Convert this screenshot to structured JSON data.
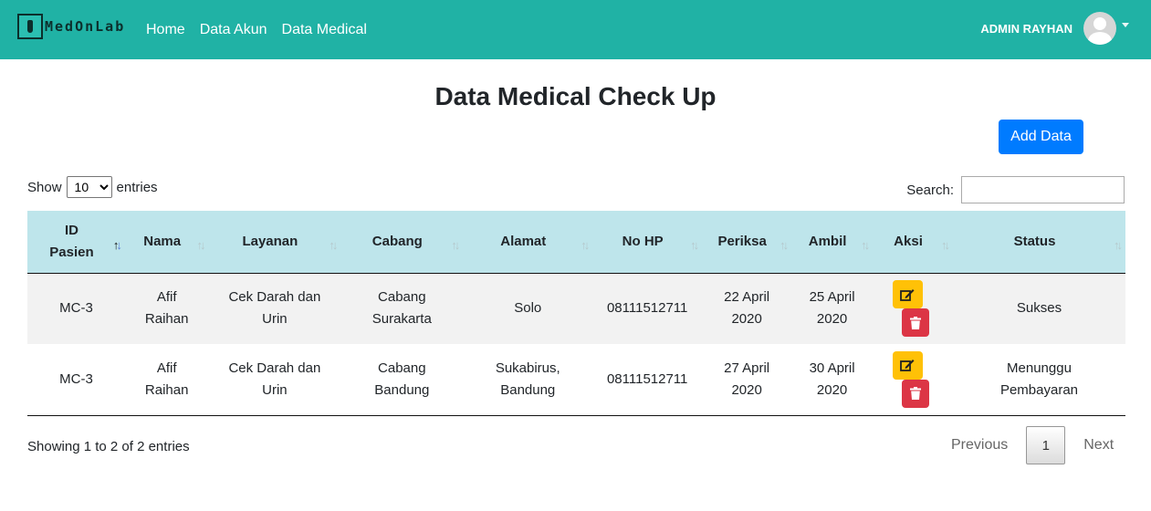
{
  "navbar": {
    "brand": "MedOnLab",
    "links": [
      "Home",
      "Data Akun",
      "Data Medical"
    ],
    "user_name": "ADMIN RAYHAN",
    "bg_color": "#20b2a5"
  },
  "page": {
    "title": "Data Medical Check Up",
    "add_button": "Add Data"
  },
  "table_controls": {
    "show_label": "Show",
    "entries_label": "entries",
    "length_value": "10",
    "search_label": "Search:",
    "search_value": ""
  },
  "table": {
    "headers": [
      "ID Pasien",
      "Nama",
      "Layanan",
      "Cabang",
      "Alamat",
      "No HP",
      "Periksa",
      "Ambil",
      "Aksi",
      "Status"
    ],
    "rows": [
      {
        "id": "MC-3",
        "nama": "Afif Raihan",
        "layanan": "Cek Darah dan Urin",
        "cabang": "Cabang Surakarta",
        "alamat": "Solo",
        "no_hp": "08111512711",
        "periksa": "22 April 2020",
        "ambil": "25 April 2020",
        "status": "Sukses"
      },
      {
        "id": "MC-3",
        "nama": "Afif Raihan",
        "layanan": "Cek Darah dan Urin",
        "cabang": "Cabang Bandung",
        "alamat": "Sukabirus, Bandung",
        "no_hp": "08111512711",
        "periksa": "27 April 2020",
        "ambil": "30 April 2020",
        "status": "Menunggu Pembayaran"
      }
    ]
  },
  "footer": {
    "info": "Showing 1 to 2 of 2 entries",
    "previous": "Previous",
    "current_page": "1",
    "next": "Next"
  }
}
